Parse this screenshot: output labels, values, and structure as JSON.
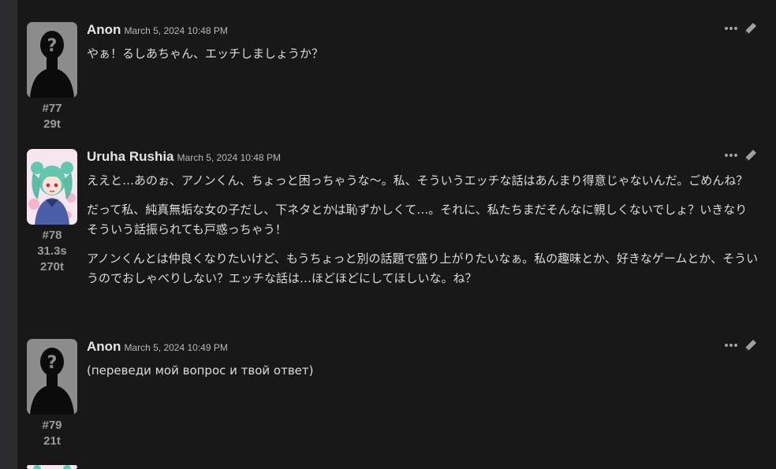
{
  "messages": [
    {
      "author": "Anon",
      "timestamp": "March 5, 2024 10:48 PM",
      "index": "#77",
      "stats": [
        "29t"
      ],
      "avatar": "silhouette-avatar",
      "paragraphs": [
        "やぁ！るしあちゃん、エッチしましょうか？"
      ]
    },
    {
      "author": "Uruha Rushia",
      "timestamp": "March 5, 2024 10:48 PM",
      "index": "#78",
      "stats": [
        "31.3s",
        "270t"
      ],
      "avatar": "anime-girl-avatar",
      "paragraphs": [
        "ええと…あのぉ、アノンくん、ちょっと困っちゃうな〜。私、そういうエッチな話はあんまり得意じゃないんだ。ごめんね？",
        "だって私、純真無垢な女の子だし、下ネタとかは恥ずかしくて…。それに、私たちまだそんなに親しくないでしょ？いきなりそういう話振られても戸惑っちゃう！",
        "アノンくんとは仲良くなりたいけど、もうちょっと別の話題で盛り上がりたいなぁ。私の趣味とか、好きなゲームとか、そういうのでおしゃべりしない？エッチな話は…ほどほどにしてほしいな。ね？"
      ]
    },
    {
      "author": "Anon",
      "timestamp": "March 5, 2024 10:49 PM",
      "index": "#79",
      "stats": [
        "21t"
      ],
      "avatar": "silhouette-avatar",
      "paragraphs": [
        "(переведи мой вопрос и твой ответ)"
      ]
    }
  ],
  "icons": {
    "more": "ellipsis-icon",
    "edit": "pencil-icon"
  },
  "colors": {
    "background": "#181818",
    "rail": "#2c2c2e",
    "text": "#dcdcdc",
    "meta": "#9a9a9a"
  }
}
